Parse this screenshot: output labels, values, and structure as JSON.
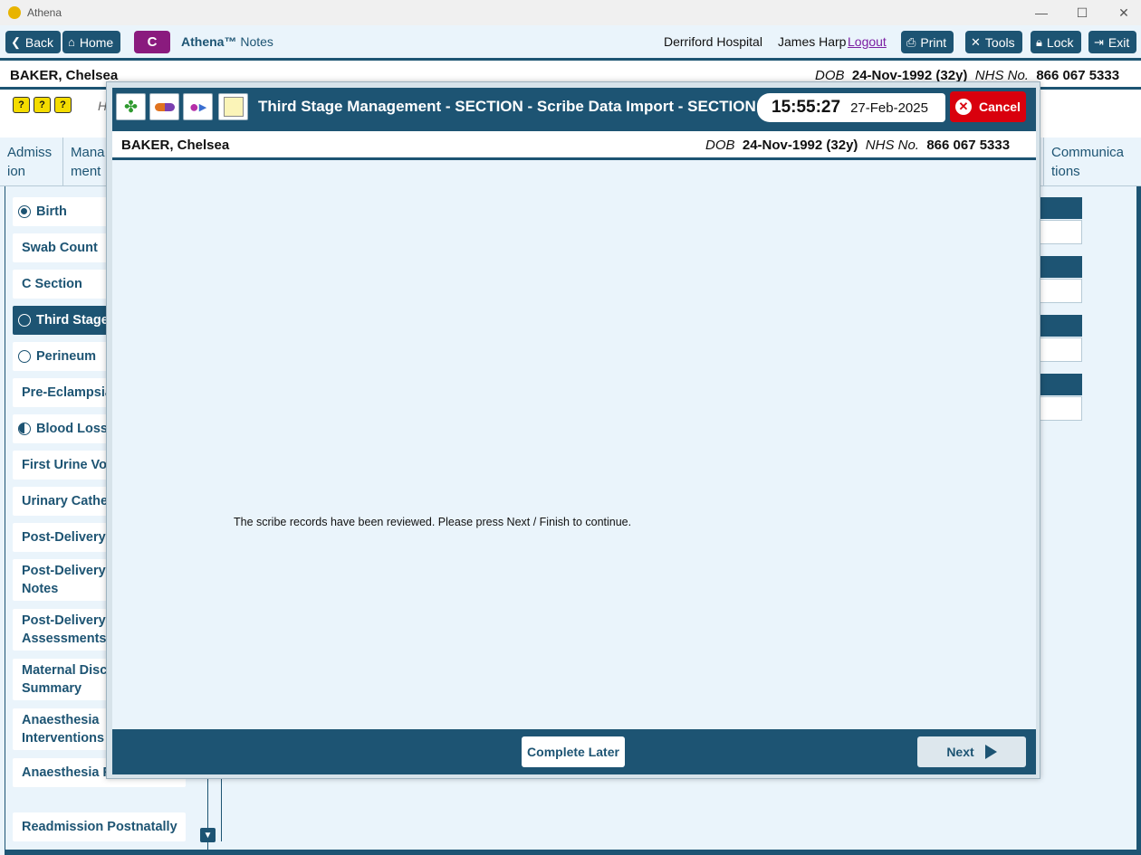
{
  "window": {
    "title": "Athena",
    "minimize": "—",
    "maximize": "☐",
    "close": "✕"
  },
  "toolbar": {
    "back": "Back",
    "home": "Home",
    "c_button": "C",
    "brand_name": "Athena™",
    "brand_sub": "Notes",
    "hospital": "Derriford Hospital",
    "user": "James Harp",
    "logout": "Logout",
    "print": "Print",
    "tools": "Tools",
    "lock": "Lock",
    "exit": "Exit"
  },
  "patient": {
    "name": "BAKER, Chelsea",
    "dob_label": "DOB",
    "dob": "24-Nov-1992 (32y)",
    "nhs_label": "NHS No.",
    "nhs": "866 067 5333"
  },
  "background": {
    "hint": "H",
    "tabs": [
      {
        "line1": "Admiss",
        "line2": "ion"
      },
      {
        "line1": "Mana",
        "line2": "ment"
      },
      {
        "line1": "Communica",
        "line2": "tions"
      }
    ],
    "nav_items": [
      {
        "label": "Birth",
        "radio": "filled"
      },
      {
        "label": "Swab Count"
      },
      {
        "label": "C Section"
      },
      {
        "label": "Third Stage",
        "radio": "empty",
        "selected": true
      },
      {
        "label": "Perineum",
        "radio": "empty"
      },
      {
        "label": "Pre-Eclampsia"
      },
      {
        "label": "Blood Loss",
        "radio": "half"
      },
      {
        "label": "First Urine Voi"
      },
      {
        "label": "Urinary Cathe"
      },
      {
        "label": "Post-Delivery"
      },
      {
        "label": "Post-Delivery Notes"
      },
      {
        "label": "Post-Delivery Assessments"
      },
      {
        "label": "Maternal Disc Summary"
      },
      {
        "label": "Anaesthesia Interventions"
      },
      {
        "label": "Anaesthesia F"
      },
      {
        "label": "Readmission Postnatally"
      }
    ]
  },
  "modal": {
    "title": "Third Stage Management - SECTION - Scribe Data Import - SECTION - S",
    "time": "15:55:27",
    "date": "27-Feb-2025",
    "cancel": "Cancel",
    "message": "The scribe records have been reviewed. Please press Next / Finish to continue.",
    "complete_later": "Complete Later",
    "next": "Next",
    "icons": [
      "clover-icon",
      "pill-icon",
      "person-arrow-icon",
      "notepad-icon"
    ]
  }
}
